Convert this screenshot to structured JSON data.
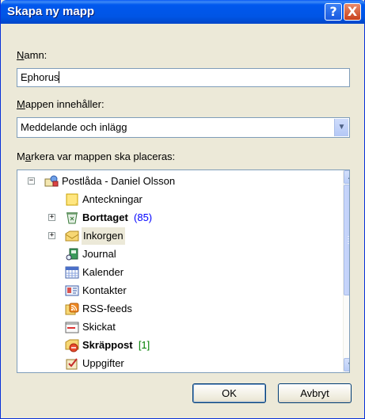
{
  "window": {
    "title": "Skapa ny mapp"
  },
  "titlebar_buttons": {
    "help": "?",
    "close": "X"
  },
  "name_field": {
    "label_ul": "N",
    "label_rest": "amn:",
    "value": "Ephorus"
  },
  "contains": {
    "label_ul": "M",
    "label_rest": "appen innehåller:",
    "selected": "Meddelande och inlägg"
  },
  "location": {
    "label_pre": "M",
    "label_ul": "a",
    "label_rest": "rkera var mappen ska placeras:"
  },
  "tree": {
    "root": {
      "label": "Postlåda - Daniel Olsson",
      "expander": "−"
    },
    "items": [
      {
        "label": "Anteckningar",
        "icon": "notes-icon"
      },
      {
        "label": "Borttaget",
        "count": "(85)",
        "icon": "deleted-items-icon",
        "expander": "+"
      },
      {
        "label": "Inkorgen",
        "icon": "inbox-icon",
        "expander": "+"
      },
      {
        "label": "Journal",
        "icon": "journal-icon"
      },
      {
        "label": "Kalender",
        "icon": "calendar-icon"
      },
      {
        "label": "Kontakter",
        "icon": "contacts-icon"
      },
      {
        "label": "RSS-feeds",
        "icon": "rss-icon"
      },
      {
        "label": "Skickat",
        "icon": "sent-items-icon"
      },
      {
        "label": "Skräppost",
        "count": "[1]",
        "icon": "junk-mail-icon"
      },
      {
        "label": "Uppgifter",
        "icon": "tasks-icon"
      }
    ]
  },
  "buttons": {
    "ok": "OK",
    "cancel": "Avbryt"
  },
  "colors": {
    "title_bar": "#0055e5",
    "unread_count": "#0000ff",
    "search_count": "#008000"
  }
}
